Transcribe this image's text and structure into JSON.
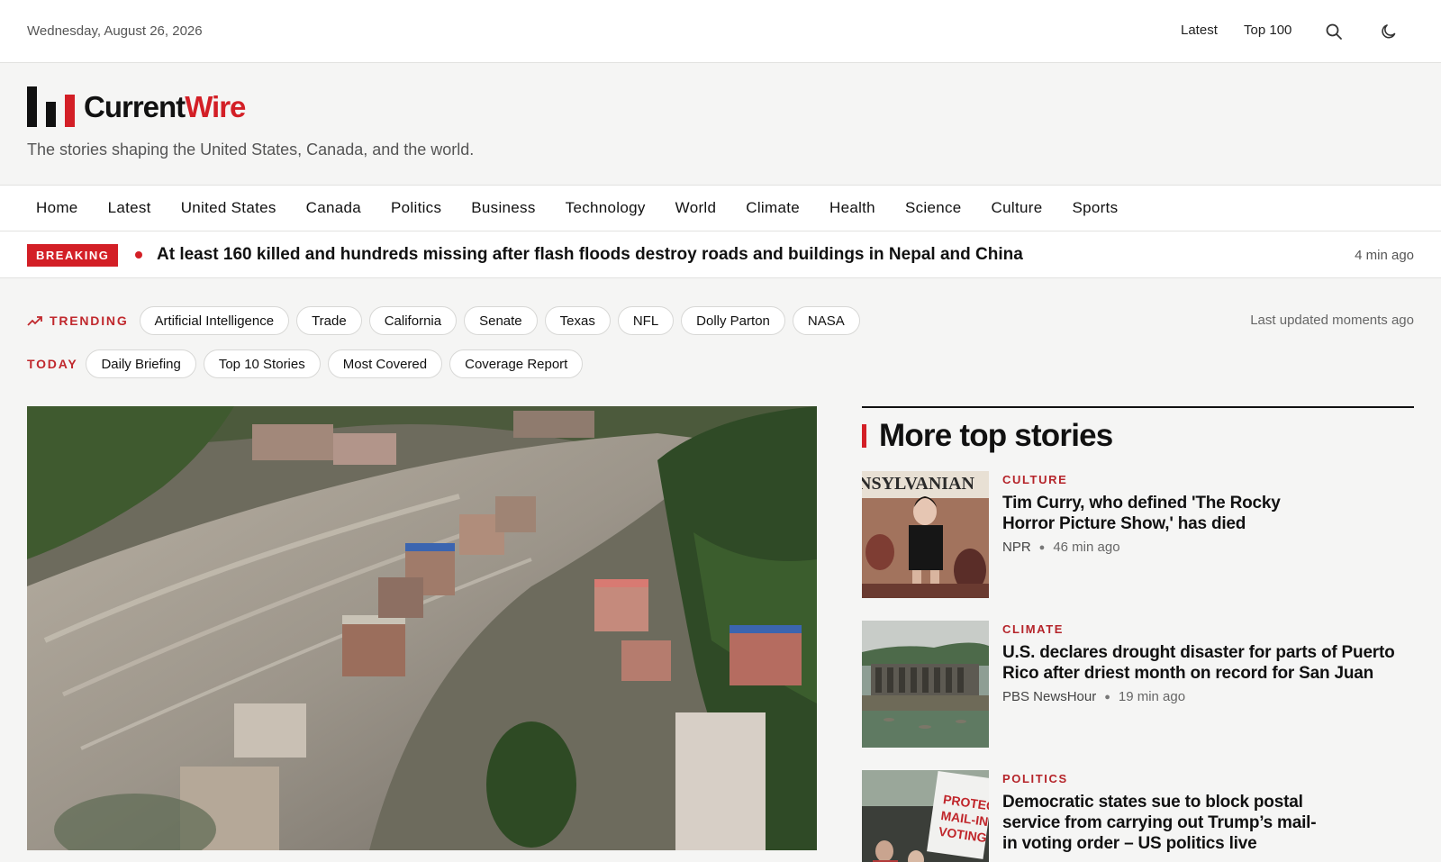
{
  "topbar": {
    "date": "Wednesday, August 26, 2026",
    "links": [
      "Latest",
      "Top 100"
    ],
    "search_icon": "search-icon",
    "theme_icon": "moon-icon"
  },
  "brand": {
    "name_part1": "Current",
    "name_part2": "Wire",
    "tagline": "The stories shaping the United States, Canada, and the world.",
    "accent_color": "#d31f26"
  },
  "nav": {
    "items": [
      "Home",
      "Latest",
      "United States",
      "Canada",
      "Politics",
      "Business",
      "Technology",
      "World",
      "Climate",
      "Health",
      "Science",
      "Culture",
      "Sports"
    ]
  },
  "breaking": {
    "label": "BREAKING",
    "headline": "At least 160 killed and hundreds missing after flash floods destroy roads and buildings in Nepal and China",
    "time": "4 min ago"
  },
  "trending": {
    "label": "TRENDING",
    "topics": [
      "Artificial Intelligence",
      "Trade",
      "California",
      "Senate",
      "Texas",
      "NFL",
      "Dolly Parton",
      "NASA"
    ],
    "updated": "Last updated moments ago"
  },
  "today": {
    "label": "TODAY",
    "links": [
      "Daily Briefing",
      "Top 10 Stories",
      "Most Covered",
      "Coverage Report"
    ]
  },
  "sidebar": {
    "title": "More top stories",
    "stories": [
      {
        "category": "CULTURE",
        "title": "Tim Curry, who defined 'The Rocky Horror Picture Show,' has died",
        "source": "NPR",
        "time": "46 min ago"
      },
      {
        "category": "CLIMATE",
        "title": "U.S. declares drought disaster for parts of Puerto Rico after driest month on record for San Juan",
        "source": "PBS NewsHour",
        "time": "19 min ago"
      },
      {
        "category": "POLITICS",
        "title": "Democratic states sue to block postal service from carrying out Trump’s mail-in voting order – US politics live"
      }
    ]
  }
}
